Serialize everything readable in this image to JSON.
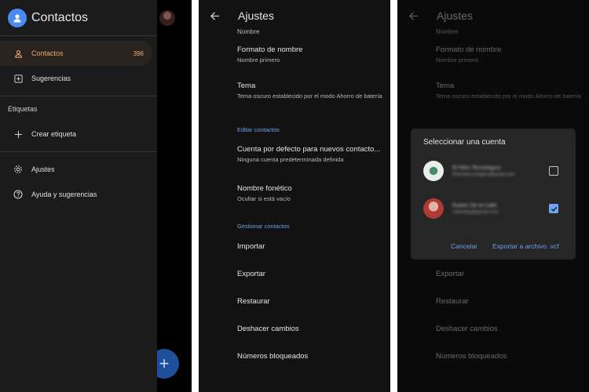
{
  "drawer": {
    "app_title": "Contactos",
    "items": [
      {
        "label": "Contactos",
        "count": "396"
      },
      {
        "label": "Sugerencias"
      }
    ],
    "labels_section": "Etiquetas",
    "create_label": "Crear etiqueta",
    "settings": "Ajustes",
    "help": "Ayuda y sugerencias",
    "fab_symbol": "+"
  },
  "settings": {
    "title": "Ajustes",
    "name_sub": "Nombre",
    "name_format": {
      "title": "Formato de nombre",
      "value": "Nombre primero"
    },
    "theme": {
      "title": "Tema",
      "value": "Tema oscuro establecido por el modo Ahorro de batería"
    },
    "edit_section": "Editar contactos",
    "default_account": {
      "title": "Cuenta por defecto para nuevos contacto...",
      "value": "Ninguna cuenta predeterminada definida"
    },
    "phonetic": {
      "title": "Nombre fonético",
      "value": "Ocultar si está vacío"
    },
    "manage_section": "Gestionar contactos",
    "import": "Importar",
    "export": "Exportar",
    "restore": "Restaurar",
    "undo": "Deshacer cambios",
    "blocked": "Números bloqueados"
  },
  "dialog": {
    "title": "Seleccionar una cuenta",
    "accounts": [
      {
        "name": "El Niño Tecnológico",
        "email": "elninotecnologico@gmail.com",
        "checked": false
      },
      {
        "name": "Rubén De la Calle",
        "email": "rubendcg@gmail.com",
        "checked": true
      }
    ],
    "cancel": "Cancelar",
    "export_vcf": "Exportar a archivo .vcf"
  },
  "colors": {
    "accent_orange": "#f0a86a",
    "accent_blue": "#6ea0f0",
    "logo_blue": "#4a8af4"
  }
}
